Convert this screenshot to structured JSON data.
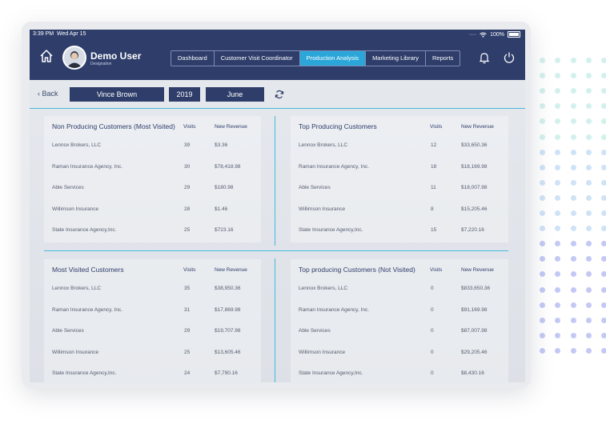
{
  "status": {
    "time": "3:39 PM",
    "date": "Wed Apr 15",
    "battery": "100%"
  },
  "user": {
    "name": "Demo User",
    "designation": "Designation"
  },
  "nav": {
    "tabs": [
      {
        "label": "Dashboard"
      },
      {
        "label": "Customer Visit Coordinator"
      },
      {
        "label": "Production Analysis",
        "active": true
      },
      {
        "label": "Marketing Library"
      },
      {
        "label": "Reports"
      }
    ]
  },
  "toolbar": {
    "back": "Back",
    "agent": "Vince Brown",
    "year": "2019",
    "month": "June"
  },
  "tables": [
    {
      "title": "Non Producing Customers (Most Visited)",
      "visits_header": "Visits",
      "revenue_header": "New Revenue",
      "rows": [
        {
          "name": "Lennox Brokers, LLC",
          "visits": "39",
          "revenue": "$3.36"
        },
        {
          "name": "Raman Insurance Agency, Inc.",
          "visits": "30",
          "revenue": "$78,418.98"
        },
        {
          "name": "Able Services",
          "visits": "29",
          "revenue": "$180.98"
        },
        {
          "name": "Willimson Insurance",
          "visits": "28",
          "revenue": "$1.46"
        },
        {
          "name": "State Insurance Agency,Inc.",
          "visits": "25",
          "revenue": "$723.16"
        }
      ]
    },
    {
      "title": "Top Producing Customers",
      "visits_header": "Visits",
      "revenue_header": "New Revenue",
      "rows": [
        {
          "name": "Lennox Brokers, LLC",
          "visits": "12",
          "revenue": "$33,650.36"
        },
        {
          "name": "Raman Insurance Agency, Inc.",
          "visits": "18",
          "revenue": "$18,169.98"
        },
        {
          "name": "Able Services",
          "visits": "11",
          "revenue": "$18,007.98"
        },
        {
          "name": "Willimson Insurance",
          "visits": "8",
          "revenue": "$15,205.46"
        },
        {
          "name": "State Insurance Agency,Inc.",
          "visits": "15",
          "revenue": "$7,220.16"
        }
      ]
    },
    {
      "title": "Most Visited Customers",
      "visits_header": "Visits",
      "revenue_header": "New Revenue",
      "rows": [
        {
          "name": "Lennox Brokers, LLC",
          "visits": "35",
          "revenue": "$38,950.36"
        },
        {
          "name": "Raman Insurance Agency, Inc.",
          "visits": "31",
          "revenue": "$17,869.98"
        },
        {
          "name": "Able Services",
          "visits": "29",
          "revenue": "$19,707.98"
        },
        {
          "name": "Willimson Insurance",
          "visits": "25",
          "revenue": "$13,605.46"
        },
        {
          "name": "State Insurance Agency,Inc.",
          "visits": "24",
          "revenue": "$7,790.16"
        }
      ]
    },
    {
      "title": "Top producing Customers (Not Visited)",
      "visits_header": "Visits",
      "revenue_header": "New Revenue",
      "rows": [
        {
          "name": "Lennox Brokers, LLC",
          "visits": "0",
          "revenue": "$833,650.36"
        },
        {
          "name": "Raman Insurance Agency, Inc.",
          "visits": "0",
          "revenue": "$91,169.98"
        },
        {
          "name": "Able Services",
          "visits": "0",
          "revenue": "$87,007.98"
        },
        {
          "name": "Willimson Insurance",
          "visits": "0",
          "revenue": "$29,205.46"
        },
        {
          "name": "State Insurance Agency,Inc.",
          "visits": "0",
          "revenue": "$8,430.16"
        }
      ]
    }
  ],
  "colors": {
    "header": "#2e3d6a",
    "active_tab": "#2aa6d8",
    "divider": "#49b8dc"
  }
}
